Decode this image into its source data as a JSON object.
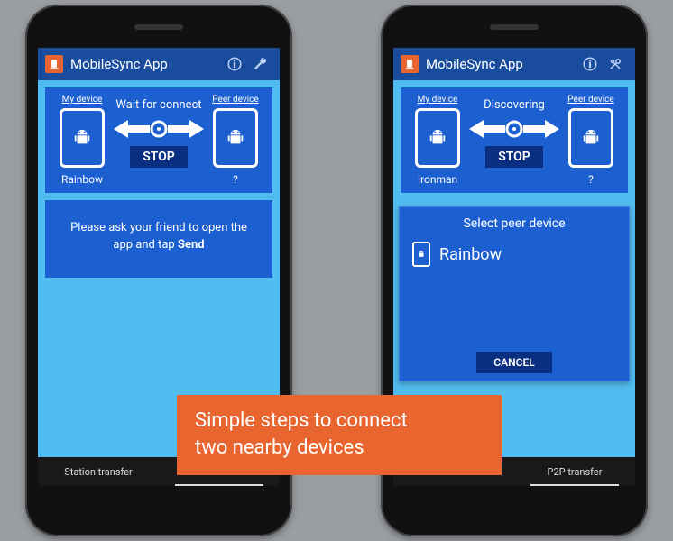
{
  "app": {
    "title": "MobileSync App"
  },
  "icons": {
    "info": "info-icon",
    "wrench": "wrench-icon",
    "tools": "tools-icon"
  },
  "labels": {
    "my_device": "My device",
    "peer_device": "Peer device",
    "stop": "STOP",
    "cancel": "CANCEL"
  },
  "tabs": {
    "station": "Station transfer",
    "p2p": "P2P transfer"
  },
  "left": {
    "status": "Wait for connect",
    "my_name": "Rainbow",
    "peer_name": "?",
    "message_pre": "Please ask your friend to open the app and tap ",
    "message_bold": "Send"
  },
  "right": {
    "status": "Discovering",
    "my_name": "Ironman",
    "peer_name": "?",
    "popup_title": "Select peer device",
    "popup_device": "Rainbow"
  },
  "caption": {
    "line1": "Simple steps to connect",
    "line2": "two nearby devices"
  }
}
